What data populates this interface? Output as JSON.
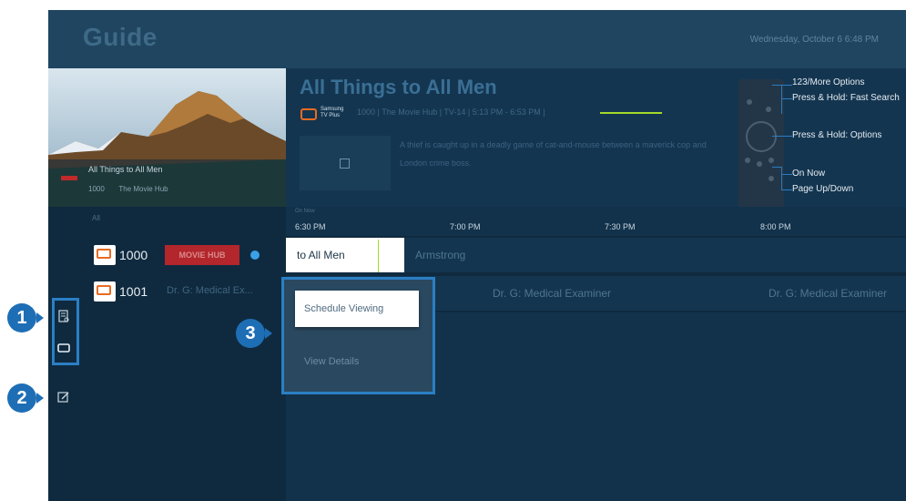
{
  "header": {
    "title": "Guide",
    "datetime": "Wednesday, October 6   6:48 PM"
  },
  "preview": {
    "title": "All Things to All Men",
    "channel": "1000",
    "network": "The Movie Hub"
  },
  "info": {
    "title": "All Things to All Men",
    "logo_text": "Samsung TV Plus",
    "meta": "1000  |  The Movie Hub  |  TV-14  |  5:13 PM - 6:53 PM  |",
    "description": "A thief is caught up in a deadly game of cat-and-mouse between a maverick cop and London crime boss."
  },
  "remote_callouts": [
    "123/More Options",
    "Press & Hold: Fast Search",
    "Press & Hold: Options",
    "On Now",
    "Page Up/Down"
  ],
  "channels": {
    "header": "All",
    "rows": [
      {
        "number": "1000",
        "name": "MOVIE HUB"
      },
      {
        "number": "1001",
        "name": "Dr. G: Medical Ex..."
      }
    ]
  },
  "timeline": {
    "now_label": "On Now",
    "ticks": [
      "6:30 PM",
      "7:00 PM",
      "7:30 PM",
      "8:00 PM"
    ]
  },
  "programs": {
    "row1": [
      "to All Men",
      "Armstrong"
    ],
    "row2": [
      "Dr. G: Medical Examiner",
      "Dr. G: Medical Examiner"
    ]
  },
  "popup": {
    "schedule_label": "Schedule Viewing",
    "details_label": "View Details"
  },
  "badges": [
    "1",
    "2",
    "3"
  ],
  "sidebar_icons": [
    "channel-filter-icon",
    "channel-list-icon",
    "edit-channels-icon"
  ],
  "colors": {
    "accent": "#2b7fc4",
    "brand_red": "#b3262b",
    "progress": "#a4d82a"
  }
}
